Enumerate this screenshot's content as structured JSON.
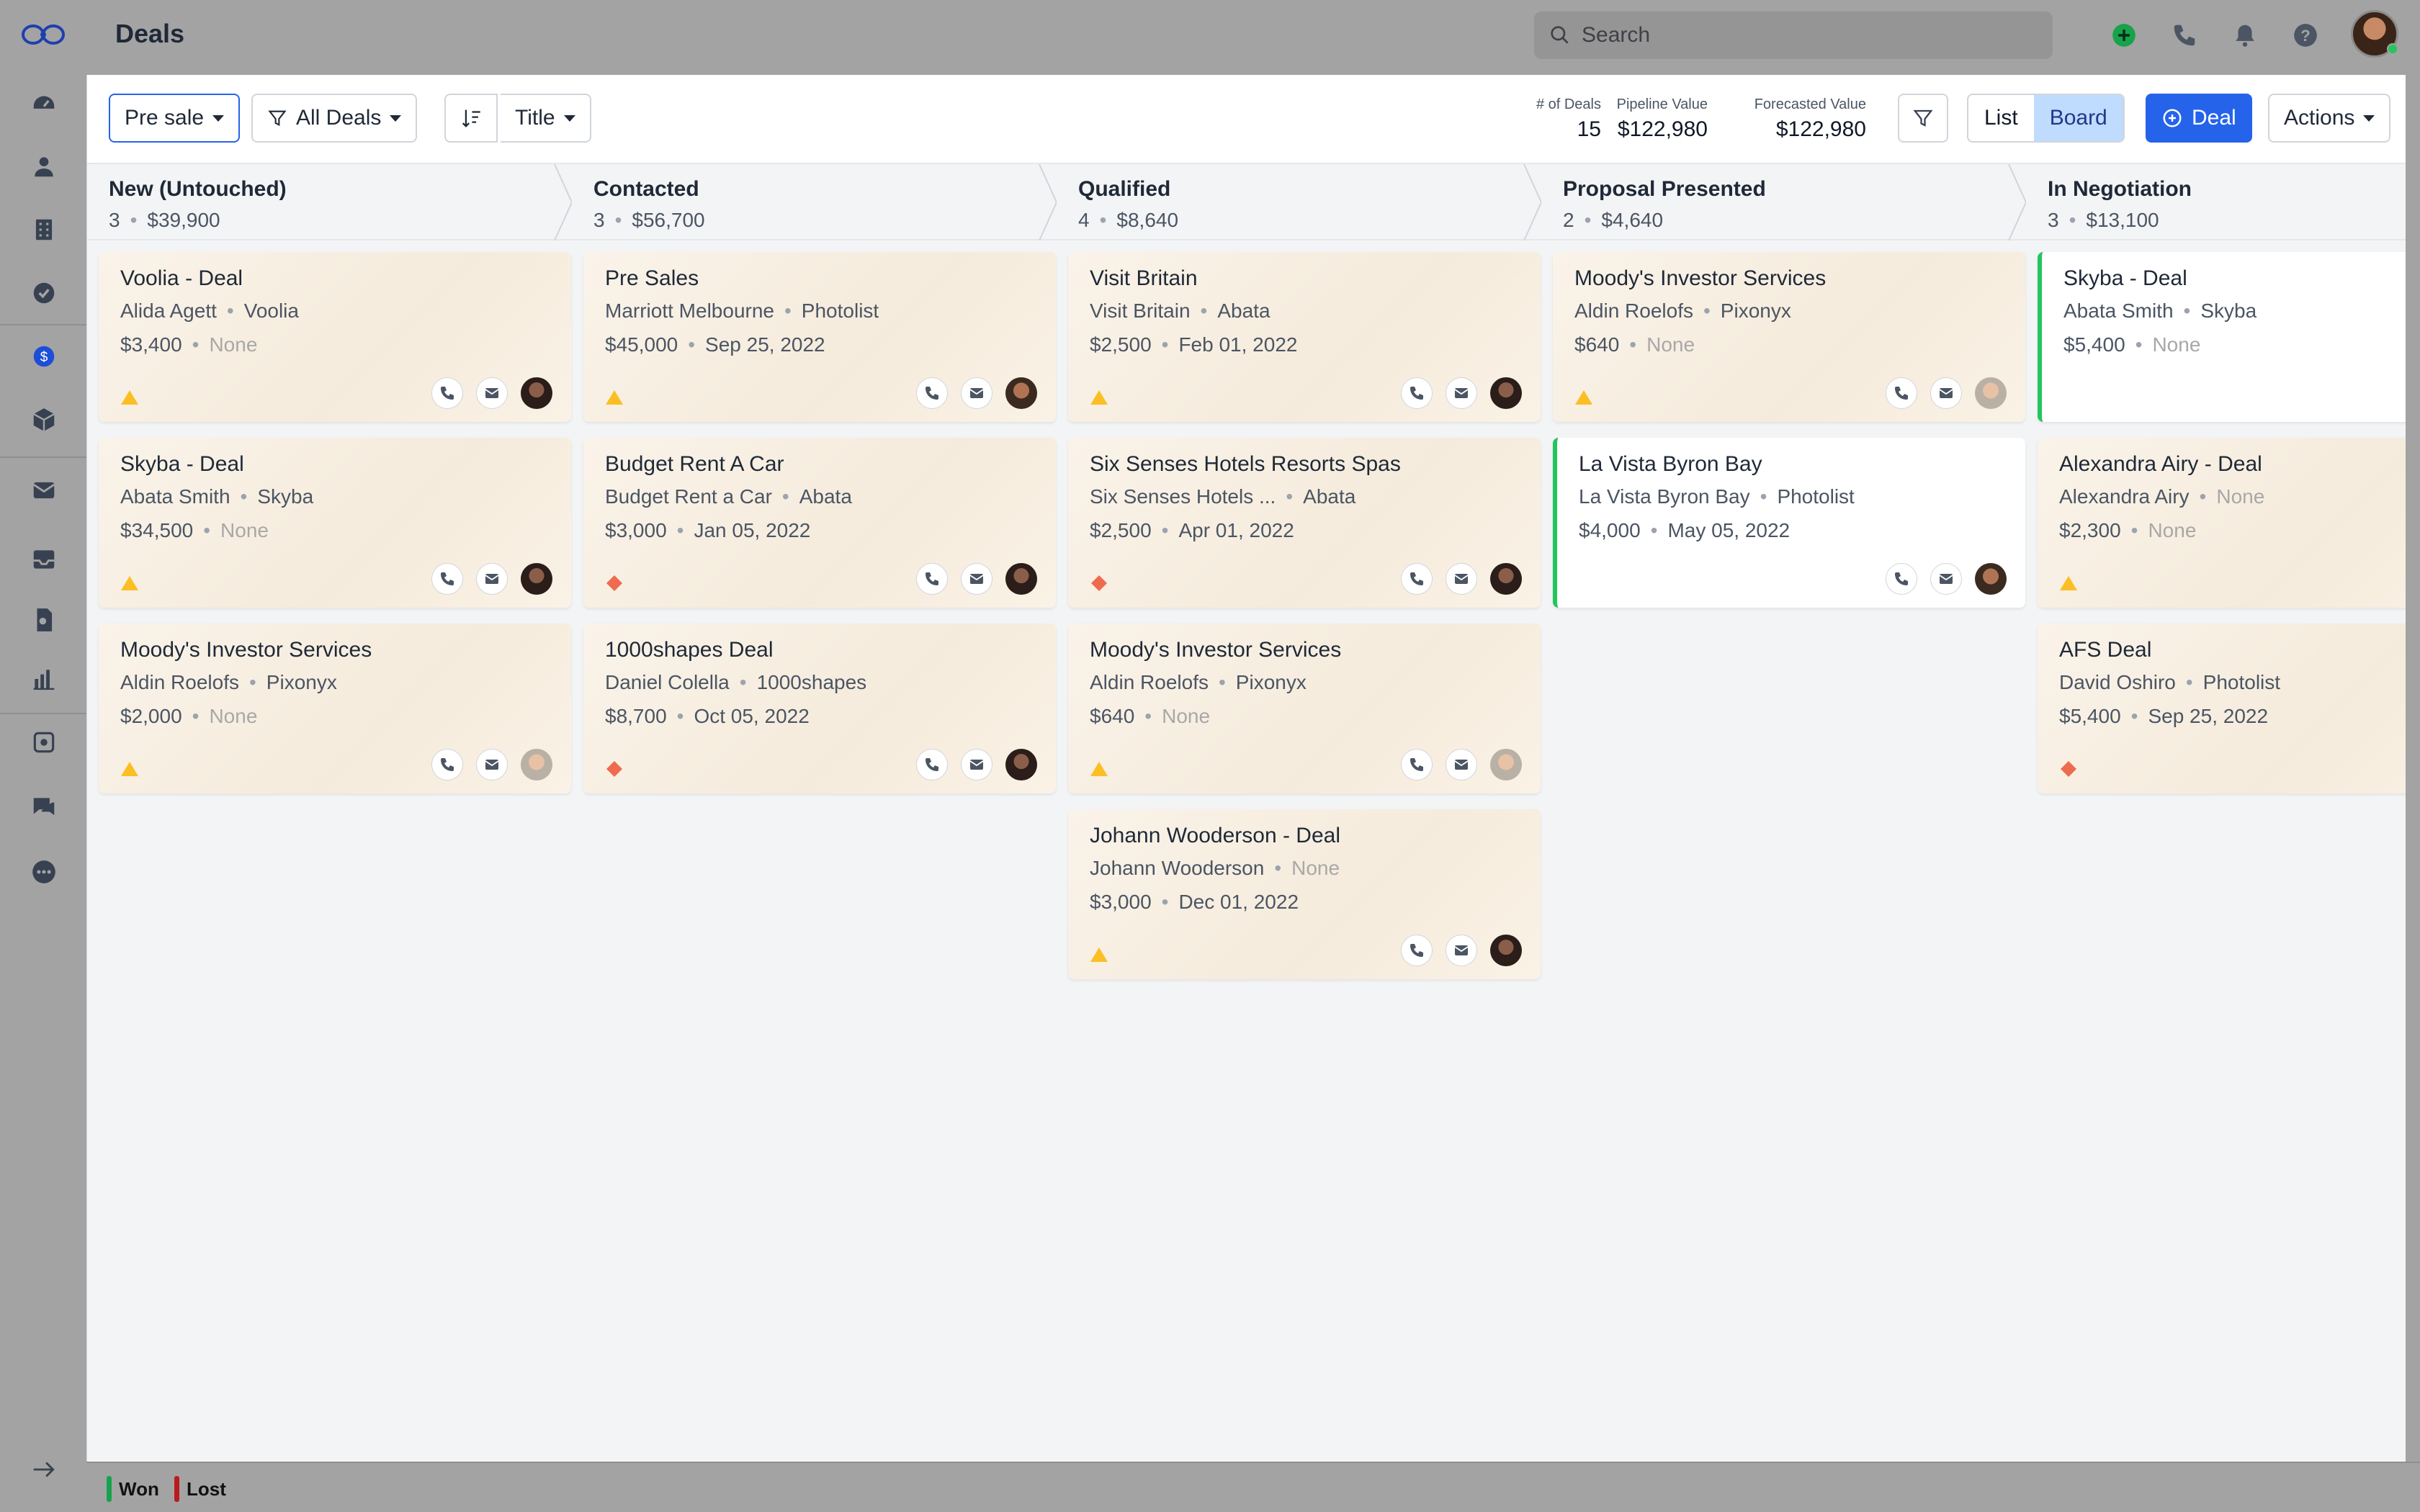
{
  "app": {
    "page_title": "Deals"
  },
  "search": {
    "placeholder": "Search"
  },
  "toolbar": {
    "pipeline": "Pre sale",
    "filter": "All Deals",
    "sort_field": "Title",
    "stats": [
      {
        "label": "# of Deals",
        "value": "15"
      },
      {
        "label": "Pipeline Value",
        "value": "$122,980"
      },
      {
        "label": "Forecasted Value",
        "value": "$122,980"
      }
    ],
    "view_list": "List",
    "view_board": "Board",
    "add_deal": "Deal",
    "actions": "Actions"
  },
  "columns": [
    {
      "name": "New (Untouched)",
      "count": "3",
      "value": "$39,900",
      "cards": [
        {
          "title": "Voolia - Deal",
          "person": "Alida Agett",
          "company": "Voolia",
          "amount": "$3,400",
          "date": "None",
          "priority": "medium",
          "avatar": "woman-dark"
        },
        {
          "title": "Skyba - Deal",
          "person": "Abata Smith",
          "company": "Skyba",
          "amount": "$34,500",
          "date": "None",
          "priority": "medium",
          "avatar": "woman-dark"
        },
        {
          "title": "Moody's Investor Services",
          "person": "Aldin Roelofs",
          "company": "Pixonyx",
          "amount": "$2,000",
          "date": "None",
          "priority": "medium",
          "avatar": "man-gray"
        }
      ]
    },
    {
      "name": "Contacted",
      "count": "3",
      "value": "$56,700",
      "cards": [
        {
          "title": "Pre Sales",
          "person": "Marriott Melbourne",
          "company": "Photolist",
          "amount": "$45,000",
          "date": "Sep 25, 2022",
          "priority": "medium",
          "avatar": "man-dark"
        },
        {
          "title": "Budget Rent A Car",
          "person": "Budget Rent a Car",
          "company": "Abata",
          "amount": "$3,000",
          "date": "Jan 05, 2022",
          "priority": "high",
          "avatar": "woman-dark"
        },
        {
          "title": "1000shapes Deal",
          "person": "Daniel Colella",
          "company": "1000shapes",
          "amount": "$8,700",
          "date": "Oct 05, 2022",
          "priority": "high",
          "avatar": "woman-dark"
        }
      ]
    },
    {
      "name": "Qualified",
      "count": "4",
      "value": "$8,640",
      "cards": [
        {
          "title": "Visit Britain",
          "person": "Visit Britain",
          "company": "Abata",
          "amount": "$2,500",
          "date": "Feb 01, 2022",
          "priority": "medium",
          "avatar": "woman-dark"
        },
        {
          "title": "Six Senses Hotels Resorts Spas",
          "person": "Six Senses Hotels ...",
          "company": "Abata",
          "amount": "$2,500",
          "date": "Apr 01, 2022",
          "priority": "high",
          "avatar": "woman-dark"
        },
        {
          "title": "Moody's Investor Services",
          "person": "Aldin Roelofs",
          "company": "Pixonyx",
          "amount": "$640",
          "date": "None",
          "priority": "medium",
          "avatar": "man-gray"
        },
        {
          "title": "Johann Wooderson - Deal",
          "person": "Johann Wooderson",
          "company": "None",
          "amount": "$3,000",
          "date": "Dec 01, 2022",
          "priority": "medium",
          "avatar": "woman-dark"
        }
      ]
    },
    {
      "name": "Proposal Presented",
      "count": "2",
      "value": "$4,640",
      "cards": [
        {
          "title": "Moody's Investor Services",
          "person": "Aldin Roelofs",
          "company": "Pixonyx",
          "amount": "$640",
          "date": "None",
          "priority": "medium",
          "avatar": "man-gray"
        },
        {
          "title": "La Vista Byron Bay",
          "person": "La Vista Byron Bay",
          "company": "Photolist",
          "amount": "$4,000",
          "date": "May 05, 2022",
          "priority": "none",
          "avatar": "man-dark",
          "won": true
        }
      ]
    },
    {
      "name": "In Negotiation",
      "count": "3",
      "value": "$13,100",
      "cards": [
        {
          "title": "Skyba - Deal",
          "person": "Abata Smith",
          "company": "Skyba",
          "amount": "$5,400",
          "date": "None",
          "priority": "none",
          "avatar": "",
          "won": true
        },
        {
          "title": "Alexandra Airy - Deal",
          "person": "Alexandra Airy",
          "company": "None",
          "amount": "$2,300",
          "date": "None",
          "priority": "medium",
          "avatar": ""
        },
        {
          "title": "AFS Deal",
          "person": "David Oshiro",
          "company": "Photolist",
          "amount": "$5,400",
          "date": "Sep 25, 2022",
          "priority": "high",
          "avatar": ""
        }
      ]
    }
  ],
  "footer": {
    "won": "Won",
    "lost": "Lost"
  },
  "colors": {
    "won": "#16a34a",
    "lost": "#b91c1c",
    "medium_priority": "#fbbf24",
    "high_priority": "#ef4444",
    "accent": "#2563eb"
  }
}
